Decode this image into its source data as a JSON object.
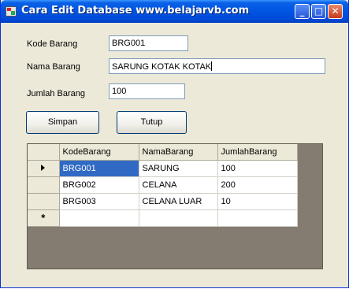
{
  "window": {
    "title": "Cara Edit Database www.belajarvb.com",
    "app_icon": "vb-form-icon",
    "controls": {
      "minimize": "_",
      "maximize": "□",
      "close": "✕"
    }
  },
  "form": {
    "kode_label": "Kode Barang",
    "kode_value": "BRG001",
    "nama_label": "Nama Barang",
    "nama_value": "SARUNG KOTAK KOTAK",
    "jumlah_label": "Jumlah Barang",
    "jumlah_value": "100"
  },
  "buttons": {
    "simpan": "Simpan",
    "tutup": "Tutup"
  },
  "grid": {
    "columns": [
      "KodeBarang",
      "NamaBarang",
      "JumlahBarang"
    ],
    "rows": [
      {
        "kode": "BRG001",
        "nama": "SARUNG",
        "jumlah": "100"
      },
      {
        "kode": "BRG002",
        "nama": "CELANA",
        "jumlah": "200"
      },
      {
        "kode": "BRG003",
        "nama": "CELANA LUAR",
        "jumlah": "10"
      }
    ],
    "current_row_marker": "▶",
    "new_row_marker": "*",
    "selected_cell": "BRG001"
  },
  "colors": {
    "title_bar": "#0054e3",
    "selection": "#316ac5",
    "grid_background": "#847c70",
    "form_background": "#ece9d8"
  }
}
